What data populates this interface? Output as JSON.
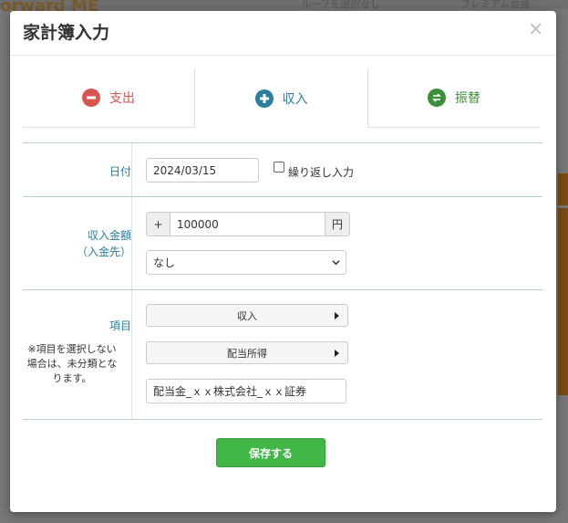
{
  "background": {
    "logo_text": "orward ME",
    "group_select": "ループを選択なし",
    "premium": "プレミアム会員"
  },
  "modal": {
    "title": "家計簿入力",
    "close": "×"
  },
  "tabs": [
    {
      "label": "支出",
      "icon": "minus-circle-icon",
      "color": "#d9534f"
    },
    {
      "label": "収入",
      "icon": "plus-circle-icon",
      "color": "#2b7ea0"
    },
    {
      "label": "振替",
      "icon": "transfer-icon",
      "color": "#3c8f3a"
    }
  ],
  "form": {
    "date": {
      "label": "日付",
      "value": "2024/03/15",
      "repeat_label": "繰り返し入力",
      "repeat_checked": false
    },
    "amount": {
      "label_line1": "収入金額",
      "label_line2": "（入金先）",
      "sign": "+",
      "value": "100000",
      "unit": "円",
      "account_selected": "なし"
    },
    "item": {
      "label": "項目",
      "note": "※項目を選択しない場合は、未分類となります。",
      "category": "収入",
      "subcategory": "配当所得",
      "memo": "配当金_ｘｘ株式会社_ｘｘ証券"
    }
  },
  "save_button": "保存する"
}
